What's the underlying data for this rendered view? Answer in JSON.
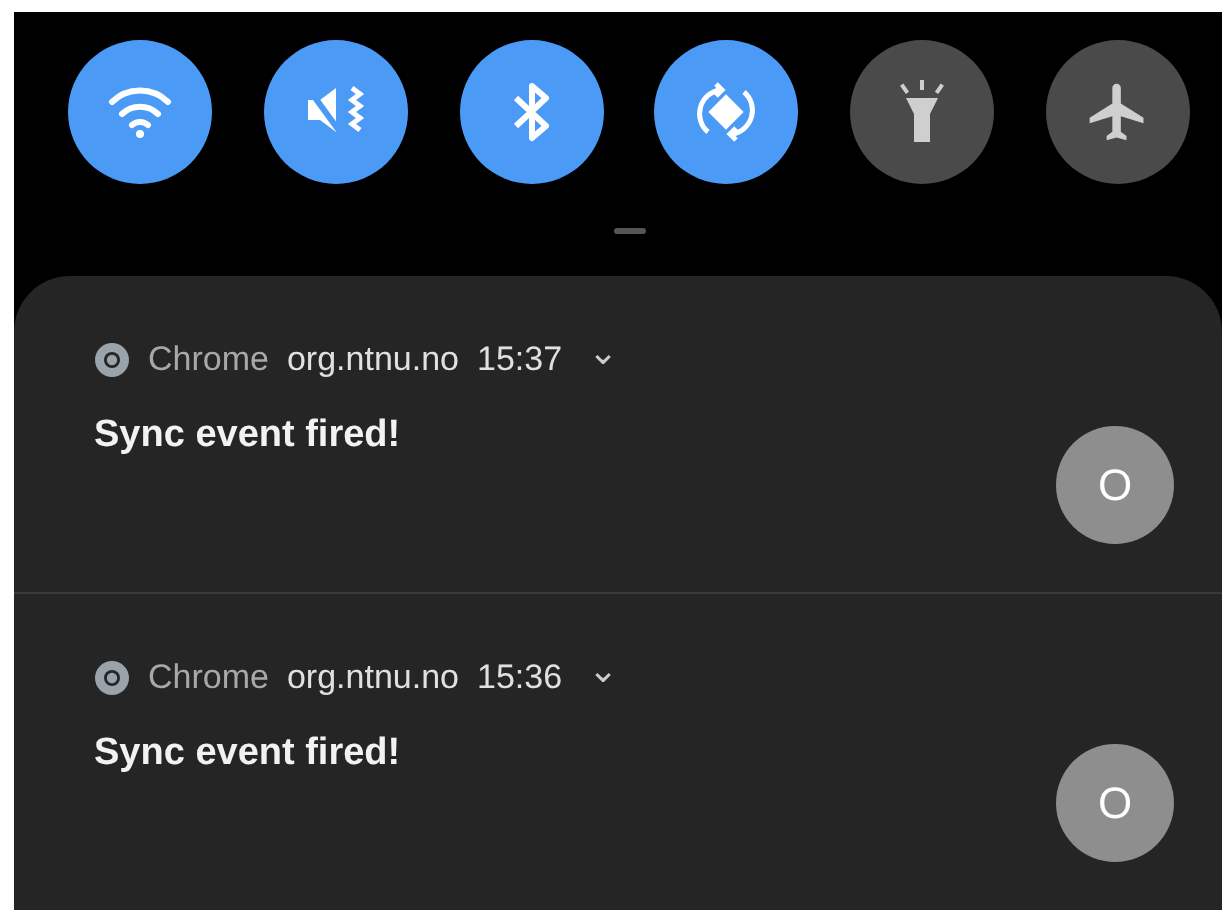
{
  "quick_toggles": [
    {
      "kind": "wifi",
      "on": true
    },
    {
      "kind": "mute-vibrate",
      "on": true
    },
    {
      "kind": "bluetooth",
      "on": true
    },
    {
      "kind": "auto-rotate",
      "on": true
    },
    {
      "kind": "flashlight",
      "on": false
    },
    {
      "kind": "airplane",
      "on": false
    }
  ],
  "notifications": [
    {
      "app": "Chrome",
      "site": "org.ntnu.no",
      "time": "15:37",
      "expand_glyph": "⌄",
      "title": "Sync event fired!",
      "avatar": "O"
    },
    {
      "app": "Chrome",
      "site": "org.ntnu.no",
      "time": "15:36",
      "expand_glyph": "⌄",
      "title": "Sync event fired!",
      "avatar": "O"
    }
  ]
}
